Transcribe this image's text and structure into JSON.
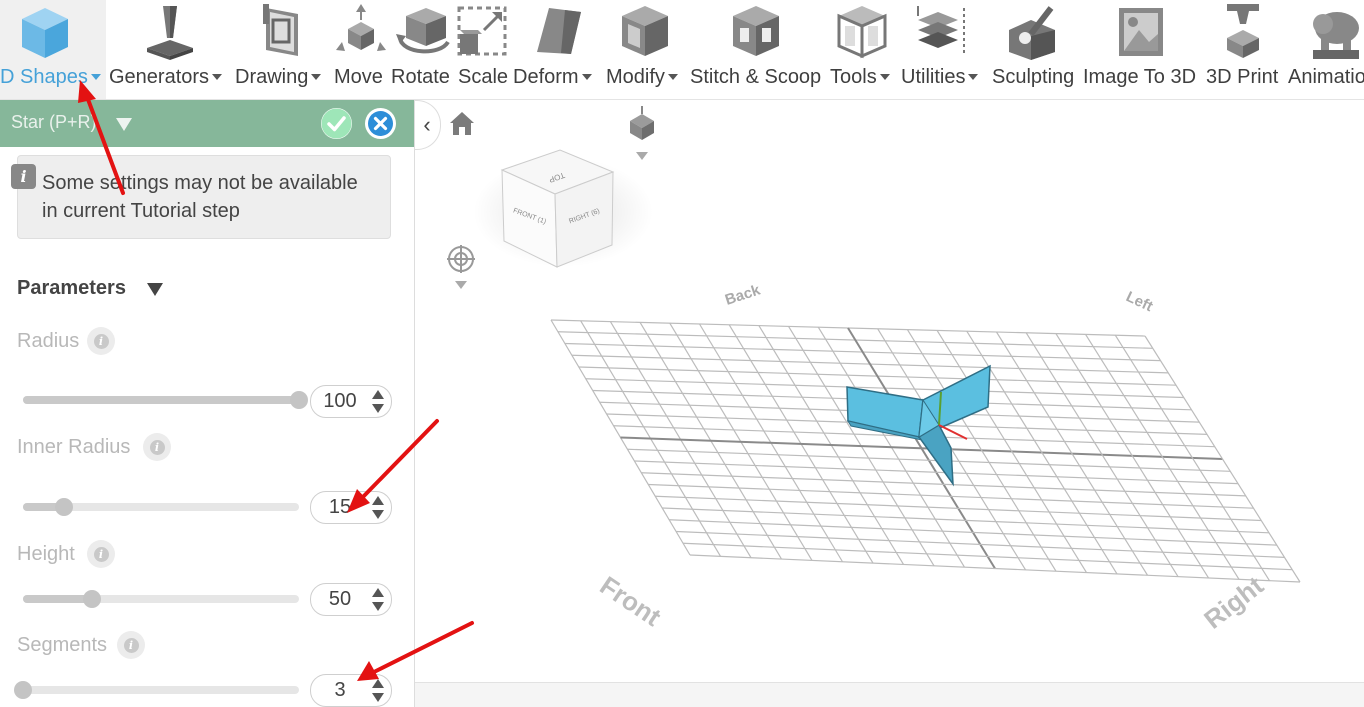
{
  "toolbar": {
    "items": [
      {
        "label": "D Shapes",
        "icon": "cube-icon",
        "caret": true,
        "active": true
      },
      {
        "label": "Generators",
        "icon": "generator-icon",
        "caret": true
      },
      {
        "label": "Drawing",
        "icon": "drawing-icon",
        "caret": true
      },
      {
        "label": "Move",
        "icon": "move-icon"
      },
      {
        "label": "Rotate",
        "icon": "rotate-icon"
      },
      {
        "label": "Scale",
        "icon": "scale-icon"
      },
      {
        "label": "Deform",
        "icon": "deform-icon",
        "caret": true
      },
      {
        "label": "Modify",
        "icon": "modify-icon",
        "caret": true
      },
      {
        "label": "Stitch & Scoop",
        "icon": "stitch-scoop-icon"
      },
      {
        "label": "Tools",
        "icon": "tools-icon",
        "caret": true
      },
      {
        "label": "Utilities",
        "icon": "utilities-icon",
        "caret": true
      },
      {
        "label": "Sculpting",
        "icon": "sculpting-icon"
      },
      {
        "label": "Image To 3D",
        "icon": "image-to-3d-icon"
      },
      {
        "label": "3D Print",
        "icon": "3d-print-icon"
      },
      {
        "label": "Animatio",
        "icon": "animation-icon"
      }
    ]
  },
  "panel": {
    "title": "Star (P+R)",
    "info_text": "Some settings may not be available in current Tutorial step",
    "parameters_heading": "Parameters",
    "params": [
      {
        "label": "Radius",
        "value": "100",
        "level": 1.0
      },
      {
        "label": "Inner Radius",
        "value": "15",
        "level": 0.15
      },
      {
        "label": "Height",
        "value": "50",
        "level": 0.25
      },
      {
        "label": "Segments",
        "value": "3",
        "level": 0.0
      }
    ]
  },
  "viewport": {
    "view_cube": {
      "top": "TOP",
      "front": "FRONT\n(1)",
      "right": "RIGHT\n(6)"
    },
    "grid_labels": {
      "back": "Back",
      "left": "Left",
      "front": "Front",
      "right": "Right"
    }
  },
  "colors": {
    "accent": "#45a1d8",
    "panel_header": "#86b79a",
    "shape": "#5bbfe0",
    "annotation": "#e31212"
  }
}
